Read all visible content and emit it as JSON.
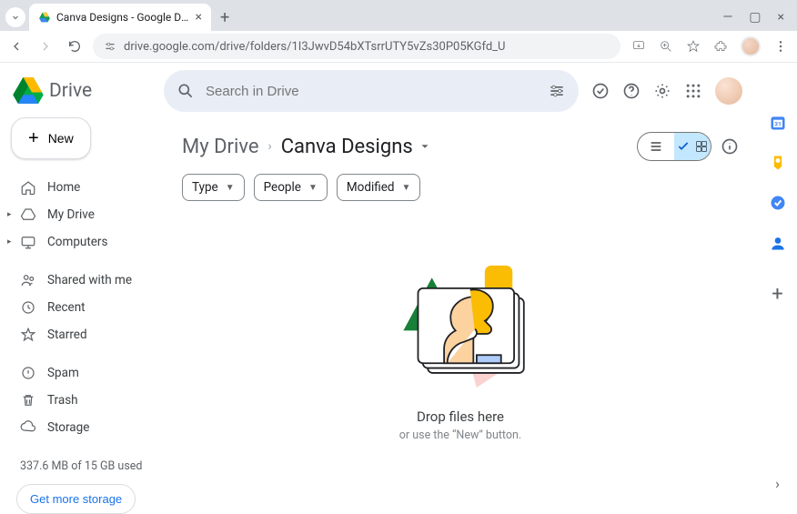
{
  "browser": {
    "tab_title": "Canva Designs - Google Drive",
    "url": "drive.google.com/drive/folders/1I3JwvD54bXTsrrUTY5vZs30P05KGfd_U"
  },
  "brand": {
    "name": "Drive"
  },
  "new_button": {
    "label": "New"
  },
  "sidebar": {
    "items": [
      {
        "label": "Home",
        "icon": "home-icon"
      },
      {
        "label": "My Drive",
        "icon": "mydrive-icon",
        "expandable": true
      },
      {
        "label": "Computers",
        "icon": "computers-icon",
        "expandable": true
      },
      {
        "label": "Shared with me",
        "icon": "shared-icon"
      },
      {
        "label": "Recent",
        "icon": "recent-icon"
      },
      {
        "label": "Starred",
        "icon": "starred-icon"
      },
      {
        "label": "Spam",
        "icon": "spam-icon"
      },
      {
        "label": "Trash",
        "icon": "trash-icon"
      },
      {
        "label": "Storage",
        "icon": "storage-icon"
      }
    ],
    "storage_used": "337.6 MB of 15 GB used",
    "get_more": "Get more storage"
  },
  "search": {
    "placeholder": "Search in Drive"
  },
  "breadcrumb": {
    "root": "My Drive",
    "current": "Canva Designs"
  },
  "filters": {
    "type": "Type",
    "people": "People",
    "modified": "Modified"
  },
  "empty": {
    "title": "Drop files here",
    "subtitle": "or use the “New” button."
  },
  "side_panel": {
    "calendar": "calendar-icon",
    "keep": "keep-icon",
    "tasks": "tasks-icon",
    "contacts": "contacts-icon"
  },
  "colors": {
    "accent": "#1a73e8",
    "grid_active_bg": "#c2e7ff"
  }
}
